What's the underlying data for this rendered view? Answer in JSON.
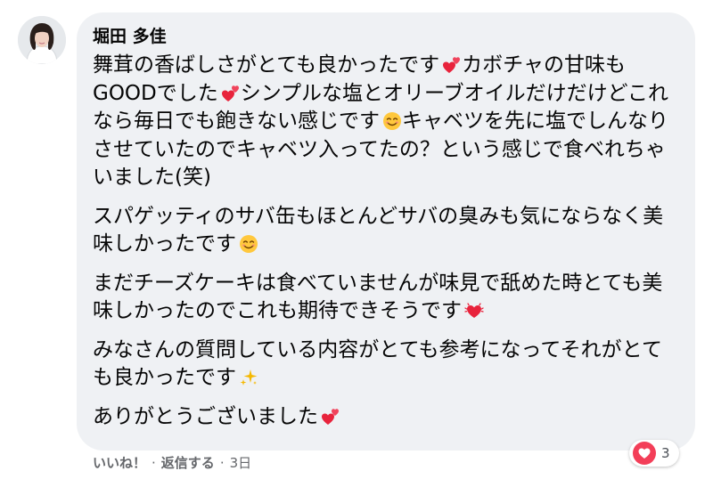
{
  "comment": {
    "author": "堀田 多佳",
    "paragraphs": [
      {
        "segments": [
          {
            "text": "舞茸の香ばしさがとても良かったです",
            "emoji": "two-hearts"
          },
          {
            "text": "カボチャの甘味もGOODでした",
            "emoji": "two-hearts"
          },
          {
            "text": "シンプルな塩とオリーブオイルだけだけどこれなら毎日でも飽きない感じです",
            "emoji": "smiling-face"
          },
          {
            "text": "キャベツを先に塩でしんなりさせていたのでキャベツ入ってたの？という感じで食べれちゃいました(笑)",
            "emoji": ""
          }
        ]
      },
      {
        "segments": [
          {
            "text": "スパゲッティのサバ缶もほとんどサバの臭みも気にならなく美味しかったです",
            "emoji": "smiling-face"
          }
        ]
      },
      {
        "segments": [
          {
            "text": "まだチーズケーキは食べていませんが味見で舐めた時とても美味しかったのでこれも期待できそうです",
            "emoji": "beating-heart"
          }
        ]
      },
      {
        "segments": [
          {
            "text": "みなさんの質問している内容がとても参考になってそれがとても良かったです",
            "emoji": "sparkles"
          }
        ]
      },
      {
        "segments": [
          {
            "text": "ありがとうございました",
            "emoji": "two-hearts"
          }
        ]
      }
    ]
  },
  "reactions": {
    "icon": "heart-icon",
    "count": "3",
    "color": "#f33e58"
  },
  "actions": {
    "like_label": "いいね！",
    "reply_label": "返信する",
    "separator": "·",
    "timestamp": "3日"
  },
  "colors": {
    "bubble": "#eff1f4",
    "text": "#050505",
    "meta": "#65676b"
  }
}
